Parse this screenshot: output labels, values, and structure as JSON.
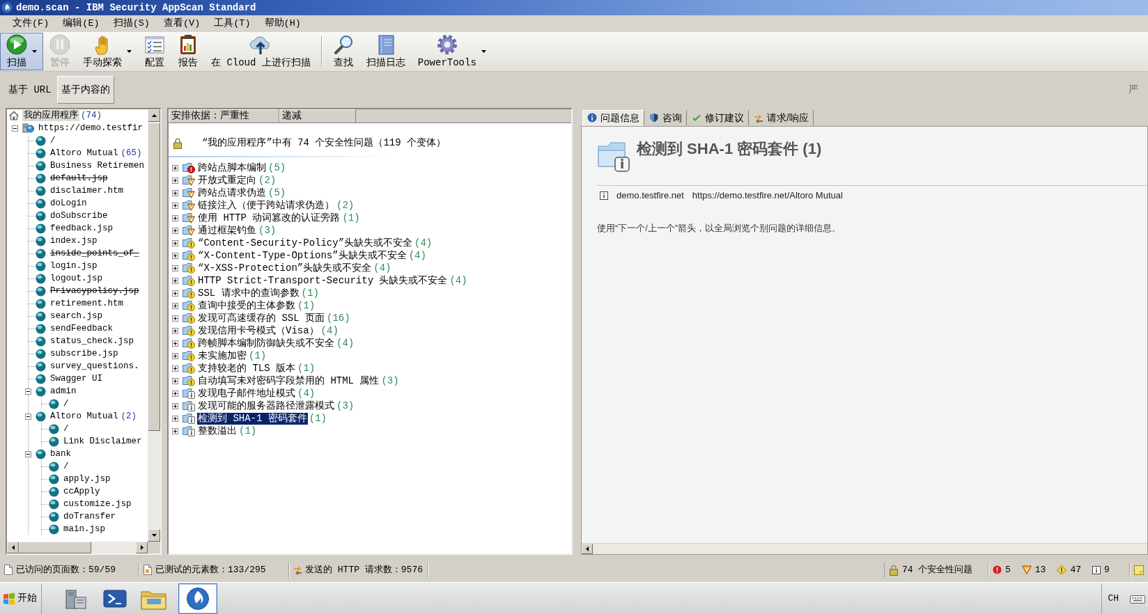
{
  "window": {
    "title": "demo.scan - IBM Security AppScan Standard"
  },
  "menu": [
    "文件(F)",
    "编辑(E)",
    "扫描(S)",
    "查看(V)",
    "工具(T)",
    "帮助(H)"
  ],
  "toolbar": [
    {
      "kind": "button",
      "label": "扫描",
      "pressed": true,
      "disabled": false,
      "has_menu": true
    },
    {
      "kind": "button",
      "label": "暂停",
      "pressed": false,
      "disabled": true,
      "has_menu": false
    },
    {
      "kind": "button",
      "label": "手动探索",
      "pressed": false,
      "disabled": false,
      "has_menu": true
    },
    {
      "kind": "button",
      "label": "配置",
      "pressed": false,
      "disabled": false,
      "has_menu": false
    },
    {
      "kind": "button",
      "label": "报告",
      "pressed": false,
      "disabled": false,
      "has_menu": false
    },
    {
      "kind": "button",
      "label": "在 Cloud 上进行扫描",
      "pressed": false,
      "disabled": false,
      "has_menu": false
    },
    {
      "kind": "separator"
    },
    {
      "kind": "button",
      "label": "查找",
      "pressed": false,
      "disabled": false,
      "has_menu": false
    },
    {
      "kind": "button",
      "label": "扫描日志",
      "pressed": false,
      "disabled": false,
      "has_menu": false
    },
    {
      "kind": "button",
      "label": "PowerTools",
      "pressed": false,
      "disabled": false,
      "has_menu": true
    }
  ],
  "view_bar": {
    "tabs": [
      {
        "label": "基于 URL",
        "selected": false
      },
      {
        "label": "基于内容的",
        "selected": true
      }
    ],
    "right_label": "严"
  },
  "tree": {
    "nodes": [
      {
        "kind": "application",
        "label": "我的应用程序",
        "count": "(74)",
        "selected": true,
        "struck": false,
        "children": [
          {
            "kind": "host",
            "label": "https://demo.testfir",
            "selected": false,
            "struck": false,
            "expanded": true,
            "children": [
              {
                "kind": "page",
                "label": "/",
                "selected": false,
                "struck": false
              },
              {
                "kind": "page",
                "label": "Altoro Mutual",
                "count": "(65)",
                "selected": false,
                "struck": false
              },
              {
                "kind": "page",
                "label": "Business Retiremen",
                "selected": false,
                "struck": false
              },
              {
                "kind": "page",
                "label": "default.jsp",
                "selected": false,
                "struck": true
              },
              {
                "kind": "page",
                "label": "disclaimer.htm",
                "selected": false,
                "struck": false
              },
              {
                "kind": "page",
                "label": "doLogin",
                "selected": false,
                "struck": false
              },
              {
                "kind": "page",
                "label": "doSubscribe",
                "selected": false,
                "struck": false
              },
              {
                "kind": "page",
                "label": "feedback.jsp",
                "selected": false,
                "struck": false
              },
              {
                "kind": "page",
                "label": "index.jsp",
                "selected": false,
                "struck": false
              },
              {
                "kind": "page",
                "label": "inside_points_of_",
                "selected": false,
                "struck": true
              },
              {
                "kind": "page",
                "label": "login.jsp",
                "selected": false,
                "struck": false
              },
              {
                "kind": "page",
                "label": "logout.jsp",
                "selected": false,
                "struck": false
              },
              {
                "kind": "page",
                "label": "Privacypolicy.jsp",
                "selected": false,
                "struck": true
              },
              {
                "kind": "page",
                "label": "retirement.htm",
                "selected": false,
                "struck": false
              },
              {
                "kind": "page",
                "label": "search.jsp",
                "selected": false,
                "struck": false
              },
              {
                "kind": "page",
                "label": "sendFeedback",
                "selected": false,
                "struck": false
              },
              {
                "kind": "page",
                "label": "status_check.jsp",
                "selected": false,
                "struck": false
              },
              {
                "kind": "page",
                "label": "subscribe.jsp",
                "selected": false,
                "struck": false
              },
              {
                "kind": "page",
                "label": "survey_questions.",
                "selected": false,
                "struck": false
              },
              {
                "kind": "page",
                "label": "Swagger UI",
                "selected": false,
                "struck": false
              },
              {
                "kind": "page",
                "label": "admin",
                "selected": false,
                "struck": false,
                "expanded": true,
                "children": [
                  {
                    "kind": "page",
                    "label": "/",
                    "selected": false,
                    "struck": false
                  }
                ]
              },
              {
                "kind": "page",
                "label": "Altoro Mutual",
                "count": "(2)",
                "selected": false,
                "struck": false,
                "expanded": true,
                "children": [
                  {
                    "kind": "page",
                    "label": "/",
                    "selected": false,
                    "struck": false
                  },
                  {
                    "kind": "page",
                    "label": "Link Disclaimer",
                    "selected": false,
                    "struck": false
                  }
                ]
              },
              {
                "kind": "page",
                "label": "bank",
                "selected": false,
                "struck": false,
                "expanded": true,
                "children": [
                  {
                    "kind": "page",
                    "label": "/",
                    "selected": false,
                    "struck": false
                  },
                  {
                    "kind": "page",
                    "label": "apply.jsp",
                    "selected": false,
                    "struck": false
                  },
                  {
                    "kind": "page",
                    "label": "ccApply",
                    "selected": false,
                    "struck": false
                  },
                  {
                    "kind": "page",
                    "label": "customize.jsp",
                    "selected": false,
                    "struck": false
                  },
                  {
                    "kind": "page",
                    "label": "doTransfer",
                    "selected": false,
                    "struck": false
                  },
                  {
                    "kind": "page",
                    "label": "main.jsp",
                    "selected": false,
                    "struck": false
                  }
                ]
              }
            ]
          }
        ]
      }
    ]
  },
  "issue_list": {
    "columns": [
      "安排依据：严重性",
      "递减"
    ],
    "summary": "“我的应用程序”中有 74 个安全性问题（119 个变体）",
    "issues": [
      {
        "label": "跨站点脚本编制",
        "count": "(5)",
        "kind": "high",
        "expanded": false,
        "selected": false
      },
      {
        "label": "开放式重定向",
        "count": "(2)",
        "kind": "medium",
        "expanded": false,
        "selected": false
      },
      {
        "label": "跨站点请求伪造",
        "count": "(5)",
        "kind": "medium",
        "expanded": false,
        "selected": false
      },
      {
        "label": "链接注入（便于跨站请求伪造）",
        "count": "(2)",
        "kind": "medium",
        "expanded": false,
        "selected": false
      },
      {
        "label": "使用 HTTP 动词篡改的认证旁路",
        "count": "(1)",
        "kind": "medium",
        "expanded": false,
        "selected": false
      },
      {
        "label": "通过框架钓鱼",
        "count": "(3)",
        "kind": "medium",
        "expanded": false,
        "selected": false
      },
      {
        "label": "“Content-Security-Policy”头缺失或不安全",
        "count": "(4)",
        "kind": "low",
        "expanded": false,
        "selected": false
      },
      {
        "label": "“X-Content-Type-Options”头缺失或不安全",
        "count": "(4)",
        "kind": "low",
        "expanded": false,
        "selected": false
      },
      {
        "label": "“X-XSS-Protection”头缺失或不安全",
        "count": "(4)",
        "kind": "low",
        "expanded": false,
        "selected": false
      },
      {
        "label": "HTTP Strict-Transport-Security 头缺失或不安全",
        "count": "(4)",
        "kind": "low",
        "expanded": false,
        "selected": false
      },
      {
        "label": "SSL 请求中的查询参数",
        "count": "(1)",
        "kind": "low",
        "expanded": false,
        "selected": false
      },
      {
        "label": "查询中接受的主体参数",
        "count": "(1)",
        "kind": "low",
        "expanded": false,
        "selected": false
      },
      {
        "label": "发现可高速缓存的 SSL 页面",
        "count": "(16)",
        "kind": "low",
        "expanded": false,
        "selected": false
      },
      {
        "label": "发现信用卡号模式（Visa）",
        "count": "(4)",
        "kind": "low",
        "expanded": false,
        "selected": false
      },
      {
        "label": "跨帧脚本编制防御缺失或不安全",
        "count": "(4)",
        "kind": "low",
        "expanded": false,
        "selected": false
      },
      {
        "label": "未实施加密",
        "count": "(1)",
        "kind": "low",
        "expanded": false,
        "selected": false
      },
      {
        "label": "支持较老的 TLS 版本",
        "count": "(1)",
        "kind": "low",
        "expanded": false,
        "selected": false
      },
      {
        "label": "自动填写未对密码字段禁用的 HTML 属性",
        "count": "(3)",
        "kind": "low",
        "expanded": false,
        "selected": false
      },
      {
        "label": "发现电子邮件地址模式",
        "count": "(4)",
        "kind": "info",
        "expanded": false,
        "selected": false
      },
      {
        "label": "发现可能的服务器路径泄露模式",
        "count": "(3)",
        "kind": "info",
        "expanded": false,
        "selected": false
      },
      {
        "label": "检测到 SHA-1 密码套件",
        "count": "(1)",
        "kind": "info",
        "expanded": false,
        "selected": true
      },
      {
        "label": "整数溢出",
        "count": "(1)",
        "kind": "info",
        "expanded": false,
        "selected": false
      }
    ]
  },
  "detail": {
    "tabs": [
      {
        "label": "问题信息",
        "selected": true
      },
      {
        "label": "咨询",
        "selected": false
      },
      {
        "label": "修订建议",
        "selected": false
      },
      {
        "label": "请求/响应",
        "selected": false
      }
    ],
    "title": "检测到 SHA-1 密码套件 (1)",
    "host": "demo.testfire.net",
    "url": "https://demo.testfire.net/Altoro Mutual",
    "hint": "使用“下一个/上一个”箭头，以全局浏览个别问题的详细信息。"
  },
  "status_bar": {
    "items": [
      "已访问的页面数：59/59",
      "已测试的元素数：133/295",
      "发送的 HTTP 请求数：9576"
    ],
    "security_summary": "74 个安全性问题",
    "counts": [
      {
        "kind": "high",
        "value": "5"
      },
      {
        "kind": "medium",
        "value": "13"
      },
      {
        "kind": "low",
        "value": "47"
      },
      {
        "kind": "info",
        "value": "9"
      }
    ]
  },
  "taskbar": {
    "start": "开始",
    "apps": [
      {
        "selected": false
      },
      {
        "selected": false
      },
      {
        "selected": false
      },
      {
        "selected": true
      }
    ],
    "language": "CH"
  }
}
